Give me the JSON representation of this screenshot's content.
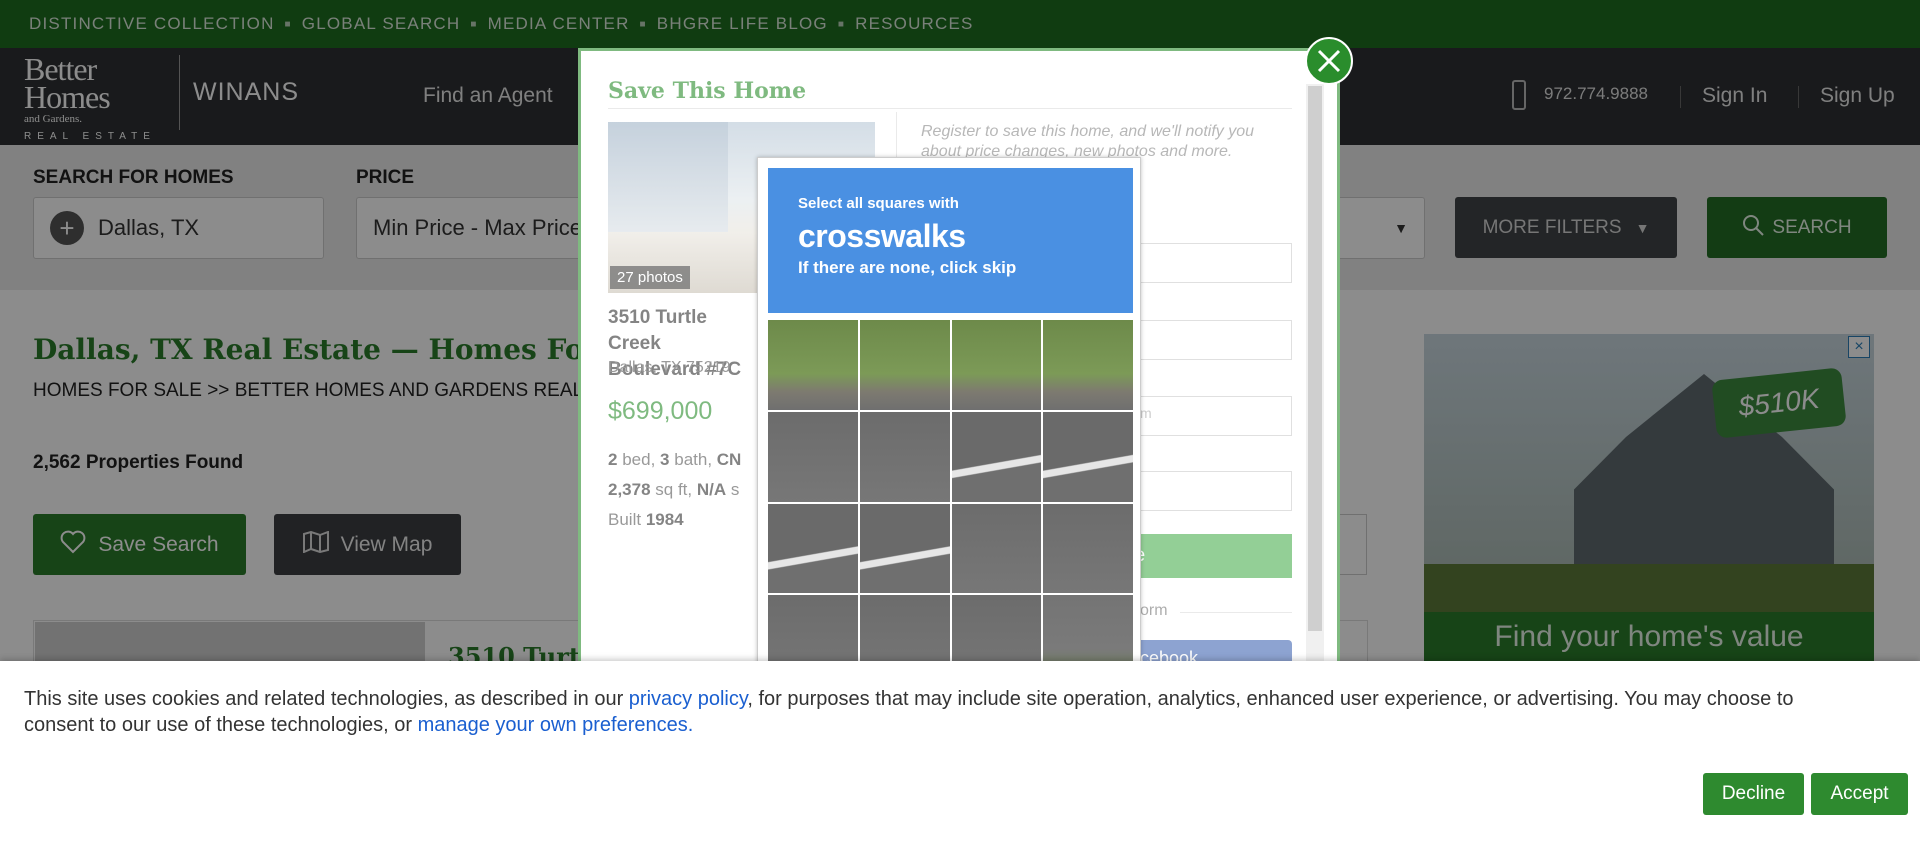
{
  "utility_nav": [
    "DISTINCTIVE COLLECTION",
    "GLOBAL SEARCH",
    "MEDIA CENTER",
    "BHGRE LIFE BLOG",
    "RESOURCES"
  ],
  "logo": {
    "line1": "Better",
    "line2": "Homes",
    "line3": "and Gardens.",
    "line4": "REAL ESTATE"
  },
  "brand": "WINANS",
  "main_nav": {
    "find_agent": "Find an Agent",
    "phone": "972.774.9888",
    "sign_in": "Sign In",
    "sign_up": "Sign Up"
  },
  "search": {
    "label_location": "SEARCH FOR HOMES",
    "location_value": "Dallas, TX",
    "label_price": "PRICE",
    "price_value": "Min Price  -  Max Price",
    "more_filters": "MORE FILTERS",
    "search_button": "SEARCH"
  },
  "results": {
    "title": "Dallas, TX Real Estate — Homes For Sale",
    "breadcrumb_home": "HOMES FOR SALE",
    "breadcrumb_sep": ">>",
    "breadcrumb_current": "BETTER HOMES AND GARDENS REAL ESTATE",
    "count": "2,562 Properties Found",
    "save_search": "Save Search",
    "view_map": "View Map",
    "first_listing_title": "3510 Turtle"
  },
  "ad": {
    "tag": "$510K",
    "banner": "Find your home's value",
    "close": "×"
  },
  "modal": {
    "title": "Save This Home",
    "photos_badge": "27 photos",
    "address": "3510 Turtle Creek Boulevard #7C",
    "city": "Dallas, TX 75219",
    "price": "$699,000",
    "beds": "2",
    "beds_label": "bed,",
    "baths": "3",
    "baths_label": "bath,",
    "type": "CN",
    "sqft": "2,378",
    "sqft_label": "sq ft,",
    "lot": "N/A",
    "lot_label": "s",
    "built_label": "Built",
    "built": "1984",
    "register_text": "Register to save this home, and we'll notify you about price changes, new photos and more.",
    "field_placeholder": "m",
    "submit_label": "ne",
    "or_text": "orm",
    "facebook_label": "cebook"
  },
  "captcha": {
    "instruction_top": "Select all squares with",
    "target": "crosswalks",
    "instruction_bottom": "If there are none, click skip"
  },
  "cookie": {
    "text_1": "This site uses cookies and related technologies, as described in our ",
    "link_privacy": "privacy policy",
    "text_2": ", for purposes that may include site operation, analytics, enhanced user experience, or advertising. You may choose to",
    "text_3": "consent to our use of these technologies, or ",
    "link_prefs": "manage your own preferences.",
    "decline": "Decline",
    "accept": "Accept"
  },
  "colors": {
    "brand_green": "#2a7d2b",
    "dark_nav": "#2e3133",
    "captcha_blue": "#4a90e2",
    "link_blue": "#1a5fd0"
  }
}
